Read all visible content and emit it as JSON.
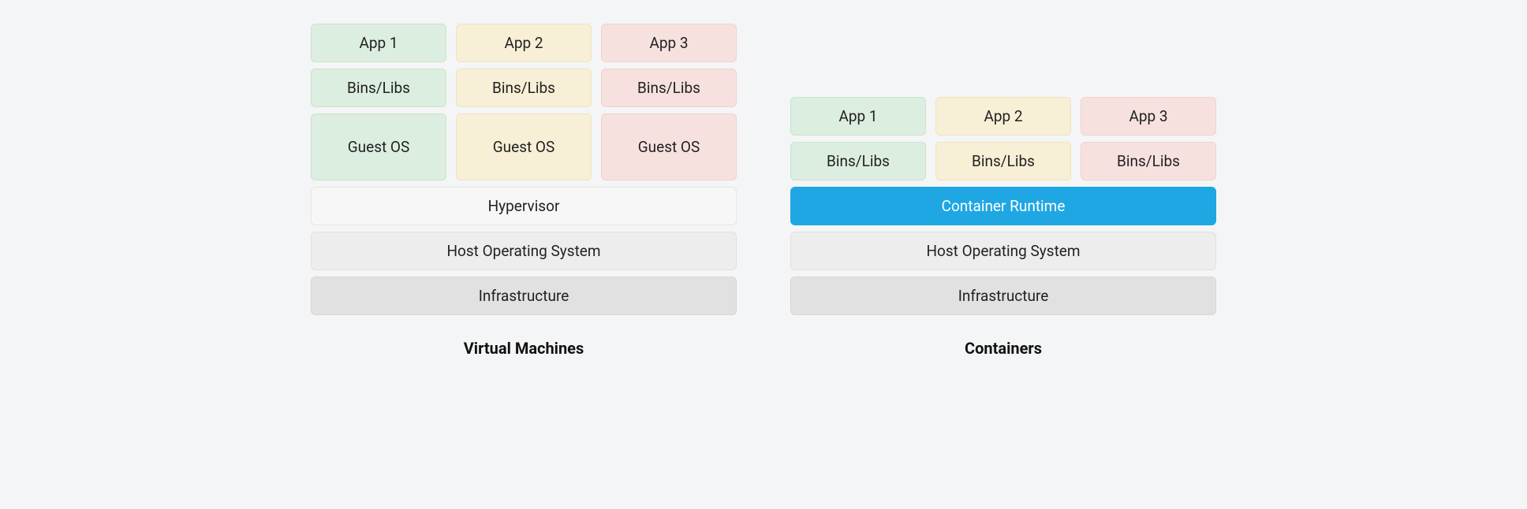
{
  "vm": {
    "title": "Virtual Machines",
    "apps": [
      "App 1",
      "App 2",
      "App 3"
    ],
    "bins": [
      "Bins/Libs",
      "Bins/Libs",
      "Bins/Libs"
    ],
    "guest": [
      "Guest OS",
      "Guest OS",
      "Guest OS"
    ],
    "hypervisor": "Hypervisor",
    "host_os": "Host Operating System",
    "infra": "Infrastructure"
  },
  "containers": {
    "title": "Containers",
    "apps": [
      "App 1",
      "App 2",
      "App 3"
    ],
    "bins": [
      "Bins/Libs",
      "Bins/Libs",
      "Bins/Libs"
    ],
    "runtime": "Container Runtime",
    "host_os": "Host Operating System",
    "infra": "Infrastructure"
  },
  "colors": {
    "green": "#dceee0",
    "yellow": "#f7efd6",
    "pink": "#f7e1df",
    "blue": "#1ea7e3",
    "background": "#f4f5f6"
  }
}
